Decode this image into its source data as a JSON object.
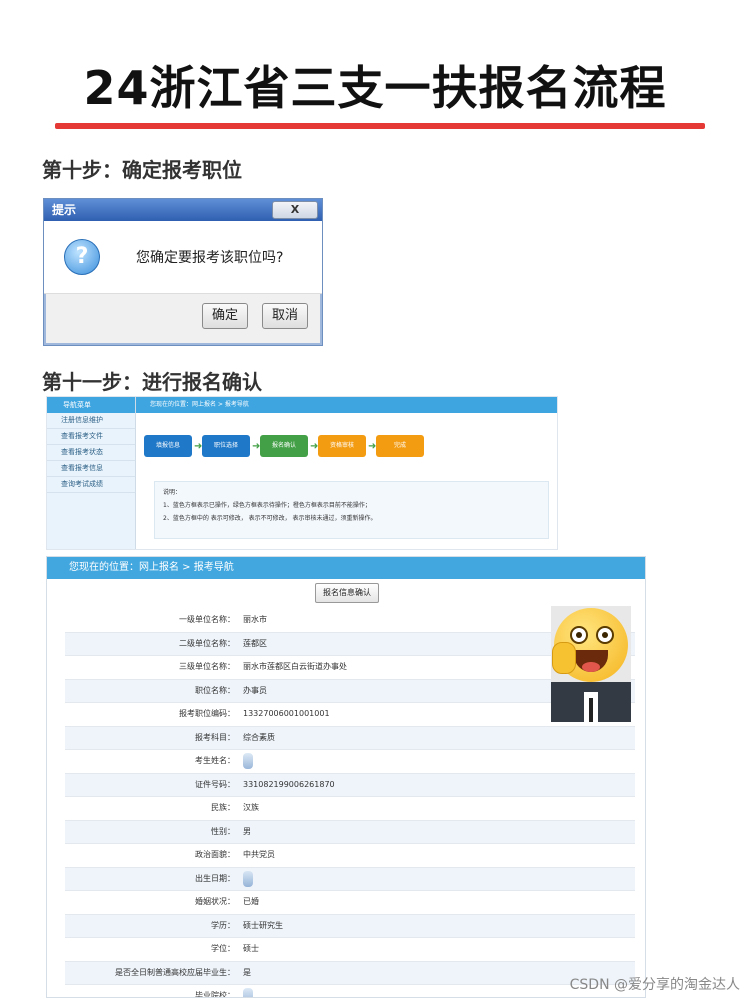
{
  "title": "24浙江省三支一扶报名流程",
  "steps": {
    "step10": "第十步：确定报考职位",
    "step11": "第十一步：进行报名确认"
  },
  "dialog": {
    "title": "提示",
    "close_label": "X",
    "message": "您确定要报考该职位吗?",
    "ok_label": "确定",
    "cancel_label": "取消",
    "icon": "question-icon"
  },
  "nav_screen": {
    "sidebar_header": "导航菜单",
    "sidebar_items": [
      "注册信息维护",
      "查看报考文件",
      "查看报考状态",
      "查看报考信息",
      "查询考试成绩"
    ],
    "breadcrumb": "您现在的位置：网上报名 > 报考导航",
    "flow_steps": [
      "填报信息",
      "职位选择",
      "报名确认",
      "资格审核",
      "完成"
    ],
    "note_title": "说明：",
    "note_lines": [
      "1、蓝色方框表示已操作，绿色方框表示待操作；橙色方框表示目前不能操作；",
      "2、蓝色方框中的 表示可修改， 表示不可修改， 表示审核未通过，须重新操作。"
    ]
  },
  "confirm_screen": {
    "breadcrumb": "您现在的位置：网上报名 > 报考导航",
    "confirm_button": "报名信息确认",
    "rows": [
      {
        "label": "一级单位名称：",
        "value": "丽水市"
      },
      {
        "label": "二级单位名称：",
        "value": "莲都区"
      },
      {
        "label": "三级单位名称：",
        "value": "丽水市莲都区白云街道办事处"
      },
      {
        "label": "职位名称：",
        "value": "办事员"
      },
      {
        "label": "报考职位编码：",
        "value": "13327006001001001"
      },
      {
        "label": "报考科目：",
        "value": "综合素质"
      },
      {
        "label": "考生姓名：",
        "value": ""
      },
      {
        "label": "证件号码：",
        "value": "331082199006261870"
      },
      {
        "label": "民族：",
        "value": "汉族"
      },
      {
        "label": "性别：",
        "value": "男"
      },
      {
        "label": "政治面貌：",
        "value": "中共党员"
      },
      {
        "label": "出生日期：",
        "value": ""
      },
      {
        "label": "婚姻状况：",
        "value": "已婚"
      },
      {
        "label": "学历：",
        "value": "硕士研究生"
      },
      {
        "label": "学位：",
        "value": "硕士"
      },
      {
        "label": "是否全日制普通高校应届毕业生：",
        "value": "是"
      },
      {
        "label": "毕业院校：",
        "value": ""
      }
    ]
  },
  "watermark": "CSDN @爱分享的淘金达人",
  "colors": {
    "accent_red": "#e53935",
    "nav_blue": "#3fa5e0",
    "step_blue": "#1f78c8",
    "step_green": "#43a047",
    "step_orange": "#f39c12"
  }
}
